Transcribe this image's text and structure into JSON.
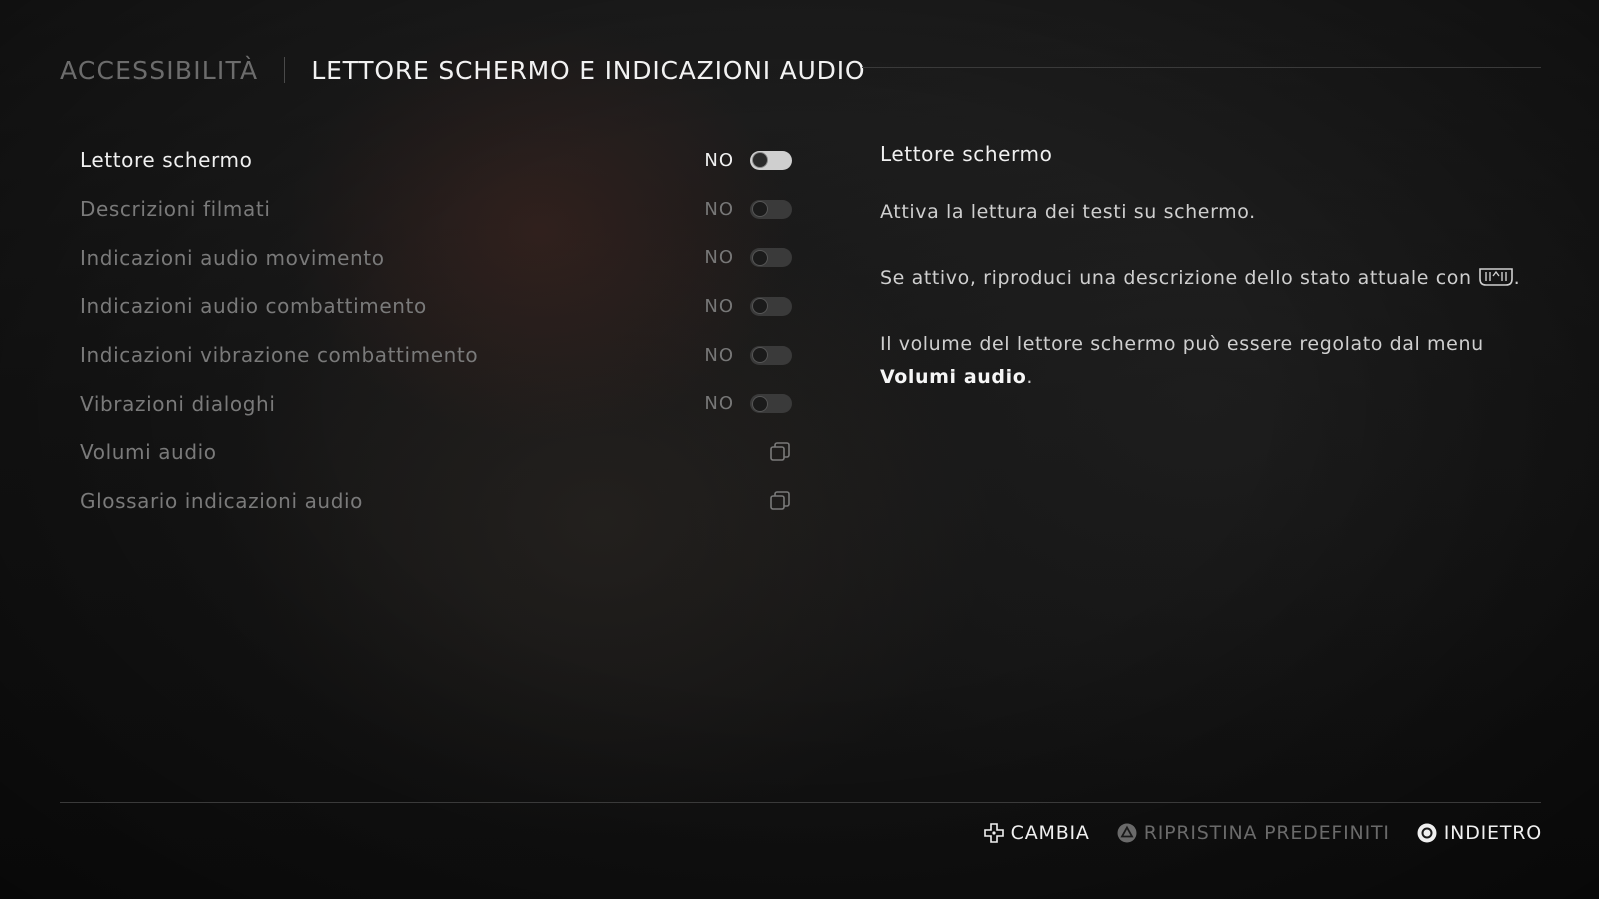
{
  "header": {
    "breadcrumb": "ACCESSIBILITÀ",
    "title": "LETTORE SCHERMO E INDICAZIONI AUDIO"
  },
  "settings": [
    {
      "label": "Lettore schermo",
      "value": "NO",
      "control": "toggle",
      "on": false,
      "selected": true
    },
    {
      "label": "Descrizioni filmati",
      "value": "NO",
      "control": "toggle",
      "on": false,
      "selected": false
    },
    {
      "label": "Indicazioni audio movimento",
      "value": "NO",
      "control": "toggle",
      "on": false,
      "selected": false
    },
    {
      "label": "Indicazioni audio combattimento",
      "value": "NO",
      "control": "toggle",
      "on": false,
      "selected": false
    },
    {
      "label": "Indicazioni vibrazione combattimento",
      "value": "NO",
      "control": "toggle",
      "on": false,
      "selected": false
    },
    {
      "label": "Vibrazioni dialoghi",
      "value": "NO",
      "control": "toggle",
      "on": false,
      "selected": false
    },
    {
      "label": "Volumi audio",
      "control": "submenu",
      "icon": "submenu-icon",
      "selected": false
    },
    {
      "label": "Glossario indicazioni audio",
      "control": "submenu",
      "icon": "submenu-icon",
      "selected": false
    }
  ],
  "description": {
    "title": "Lettore schermo",
    "para1": "Attiva la lettura dei testi su schermo.",
    "para2_before": "Se attivo, riproduci una descrizione dello stato attuale con",
    "para2_icon": "touchpad-icon",
    "para2_after": ".",
    "para3_before": "Il volume del lettore schermo può essere regolato dal menu",
    "para3_strong": "Volumi audio",
    "para3_after": "."
  },
  "footer": {
    "change": {
      "label": "CAMBIA",
      "icon": "dpad-icon"
    },
    "reset": {
      "label": "RIPRISTINA PREDEFINITI",
      "icon": "triangle-button-icon"
    },
    "back": {
      "label": "INDIETRO",
      "icon": "circle-button-icon"
    }
  }
}
